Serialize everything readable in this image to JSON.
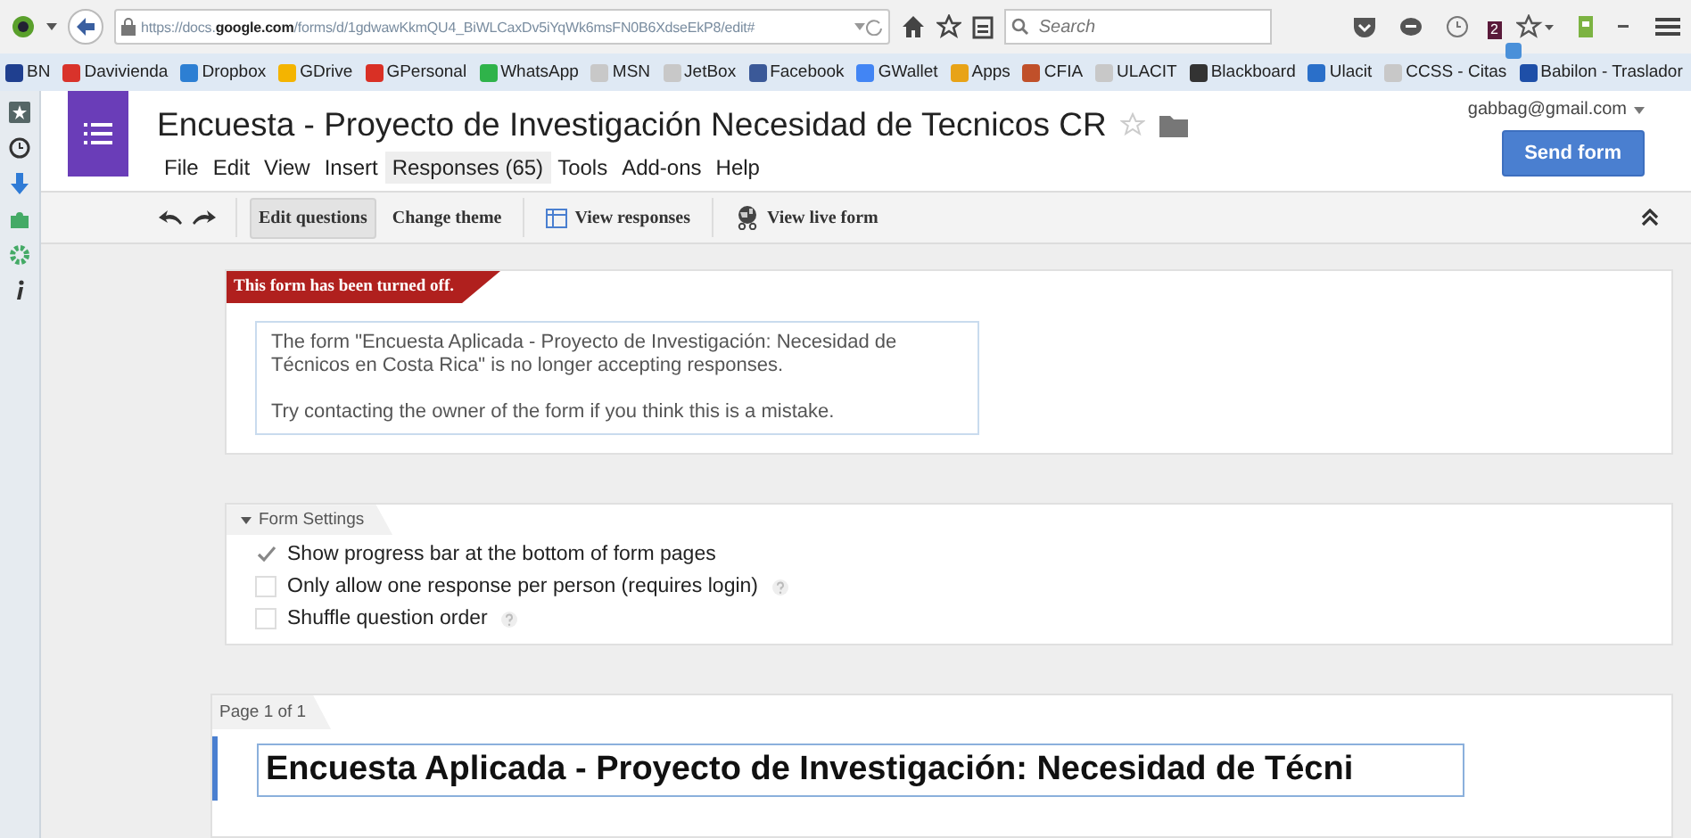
{
  "browser": {
    "url": "https://docs.google.com/forms/d/1gdwawKkmQU4_BiWLCaxDv5iYqWk6msFN0B6XdseEkP8/edit#",
    "search": {
      "placeholder": "Search"
    },
    "notification_badge": "2",
    "bookmarks": [
      {
        "label": "BN",
        "color": "#1f3f8f"
      },
      {
        "label": "Davivienda",
        "color": "#d9332b"
      },
      {
        "label": "Dropbox",
        "color": "#2d7fd3"
      },
      {
        "label": "GDrive",
        "color": "#f4b400"
      },
      {
        "label": "GPersonal",
        "color": "#d93025"
      },
      {
        "label": "WhatsApp",
        "color": "#2fb34a"
      },
      {
        "label": "MSN",
        "color": "#c8c8c8"
      },
      {
        "label": "JetBox",
        "color": "#c8c8c8"
      },
      {
        "label": "Facebook",
        "color": "#3b5998"
      },
      {
        "label": "GWallet",
        "color": "#4285f4"
      },
      {
        "label": "Apps",
        "color": "#e8a317"
      },
      {
        "label": "CFIA",
        "color": "#c0502a"
      },
      {
        "label": "ULACIT",
        "color": "#c8c8c8"
      },
      {
        "label": "Blackboard",
        "color": "#333333"
      },
      {
        "label": "Ulacit",
        "color": "#2a6fc9"
      },
      {
        "label": "CCSS - Citas",
        "color": "#c8c8c8"
      },
      {
        "label": "Babilon - Traslador",
        "color": "#1e4fa8"
      }
    ]
  },
  "document": {
    "title": "Encuesta - Proyecto de Investigación Necesidad de Tecnicos CR",
    "account": "gabbag@gmail.com",
    "send_button": "Send form",
    "menu": [
      {
        "label": "File",
        "selected": false
      },
      {
        "label": "Edit",
        "selected": false
      },
      {
        "label": "View",
        "selected": false
      },
      {
        "label": "Insert",
        "selected": false
      },
      {
        "label": "Responses (65)",
        "selected": true
      },
      {
        "label": "Tools",
        "selected": false
      },
      {
        "label": "Add-ons",
        "selected": false
      },
      {
        "label": "Help",
        "selected": false
      }
    ]
  },
  "toolbar": [
    {
      "label": "Edit questions",
      "selected": true,
      "kind": "plain"
    },
    {
      "label": "Change theme",
      "selected": false,
      "kind": "plain"
    },
    {
      "label": "View responses",
      "selected": false,
      "kind": "grid"
    },
    {
      "label": "View live form",
      "selected": false,
      "kind": "live"
    }
  ],
  "notice": {
    "banner": "This form has been turned off.",
    "paragraphs": [
      "The form \"Encuesta Aplicada - Proyecto de Investigación: Necesidad de Técnicos en Costa Rica\" is no longer accepting responses.",
      "Try contacting the owner of the form if you think this is a mistake."
    ]
  },
  "form_settings": {
    "title": "Form Settings",
    "options": [
      {
        "label": "Show progress bar at the bottom of form pages",
        "checked": true,
        "help": false
      },
      {
        "label": "Only allow one response per person (requires login)",
        "checked": false,
        "help": true
      },
      {
        "label": "Shuffle question order",
        "checked": false,
        "help": true
      }
    ]
  },
  "page": {
    "label": "Page 1 of 1",
    "title_value": "Encuesta Aplicada - Proyecto de Investigación: Necesidad de Técni"
  }
}
